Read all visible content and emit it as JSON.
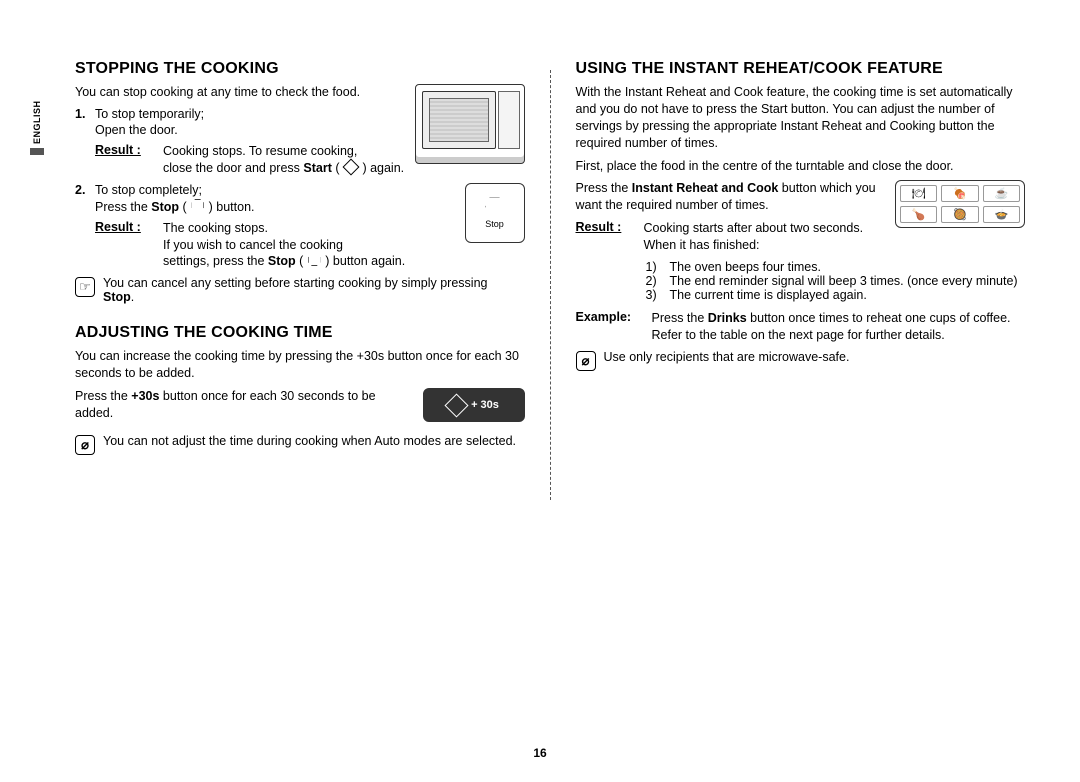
{
  "lang_tab": "ENGLISH",
  "page_number": "16",
  "left": {
    "section1": {
      "heading": "STOPPING THE COOKING",
      "intro": "You can stop cooking at any time to check the food.",
      "step1_num": "1.",
      "step1_line1": "To stop temporarily;",
      "step1_line2": "Open the door.",
      "result_label": "Result :",
      "step1_result_a": "Cooking stops. To resume cooking,",
      "step1_result_b": "close the door and press ",
      "step1_result_start": "Start",
      "step1_result_c": " ( ",
      "step1_result_d": " ) again.",
      "step2_num": "2.",
      "step2_line1": "To stop completely;",
      "step2_line2a": "Press the ",
      "step2_stop": "Stop",
      "step2_line2b": " ( ",
      "step2_line2c": " ) button.",
      "step2_result_a": "The cooking stops.",
      "step2_result_b": "If you wish to cancel the cooking",
      "step2_result_c1": "settings, press the ",
      "step2_result_c2": " ( ",
      "step2_result_c3": " ) button again.",
      "note_a": "You can cancel any setting before starting cooking by simply pressing ",
      "note_stop": "Stop",
      "note_b": "."
    },
    "section2": {
      "heading": "ADJUSTING THE COOKING TIME",
      "intro": "You can increase the cooking time by pressing the +30s button once for each 30 seconds to be added.",
      "press_a": "Press the ",
      "press_30s": "+30s",
      "press_b": " button once for each 30 seconds to be added.",
      "fig_label": "+ 30s",
      "note": "You can not adjust the time during cooking when Auto modes are selected."
    }
  },
  "right": {
    "heading": "USING THE INSTANT REHEAT/COOK FEATURE",
    "p1": "With the Instant Reheat and Cook feature, the cooking time is set automatically and you do not have to press the Start button. You can adjust the number of servings by pressing the appropriate Instant Reheat and Cooking button the required number of times.",
    "p2": "First, place the food in the centre of the turntable and close the door.",
    "p3_a": "Press the ",
    "p3_bold": "Instant Reheat and Cook",
    "p3_b": " button which you want the required number of times.",
    "result_label": "Result :",
    "result_body": "Cooking starts after about two seconds. When it has finished:",
    "enum1_n": "1)",
    "enum1_t": "The oven beeps four times.",
    "enum2_n": "2)",
    "enum2_t": "The end reminder signal will beep 3 times. (once every minute)",
    "enum3_n": "3)",
    "enum3_t": "The current time is displayed again.",
    "example_label": "Example:",
    "example_a": "Press the ",
    "example_drinks": "Drinks",
    "example_b": " button once times to reheat one cups of coffee. Refer to the table on the next page for further details.",
    "note": "Use only recipients that are microwave-safe.",
    "presets": {
      "a": "🍽",
      "b": "🍖",
      "c": "☕",
      "d": "🍗",
      "e": "🥘",
      "f": "🍲"
    },
    "stop_fig_label": "Stop"
  }
}
